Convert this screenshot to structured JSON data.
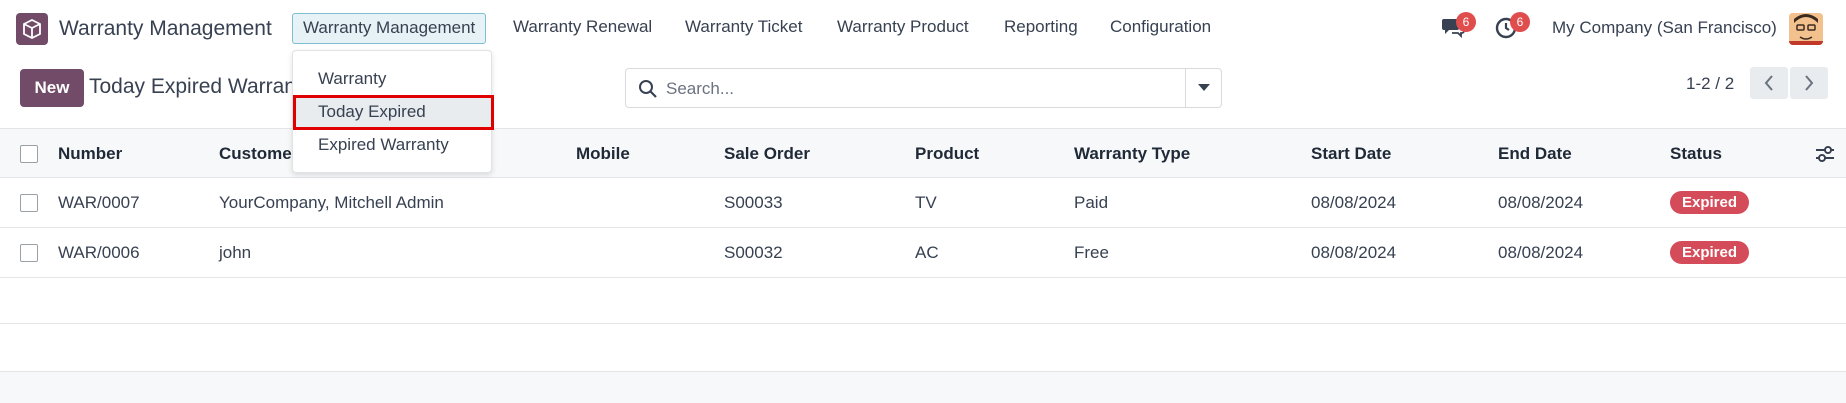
{
  "navbar": {
    "app_name": "Warranty Management",
    "menus": [
      "Warranty Management",
      "Warranty Renewal",
      "Warranty Ticket",
      "Warranty Product",
      "Reporting",
      "Configuration"
    ],
    "messages_count": "6",
    "activities_count": "6",
    "company": "My Company (San Francisco)"
  },
  "dropdown": {
    "items": [
      "Warranty",
      "Today Expired",
      "Expired Warranty"
    ],
    "highlighted": "Today Expired"
  },
  "control_panel": {
    "new_label": "New",
    "title": "Today Expired Warranty",
    "search_placeholder": "Search...",
    "pager": "1-2 / 2"
  },
  "table": {
    "columns": [
      "Number",
      "Customer",
      "Mobile",
      "Sale Order",
      "Product",
      "Warranty Type",
      "Start Date",
      "End Date",
      "Status"
    ],
    "rows": [
      {
        "number": "WAR/0007",
        "customer": "YourCompany, Mitchell Admin",
        "mobile": "",
        "sale_order": "S00033",
        "product": "TV",
        "warranty_type": "Paid",
        "start_date": "08/08/2024",
        "end_date": "08/08/2024",
        "status": "Expired"
      },
      {
        "number": "WAR/0006",
        "customer": "john",
        "mobile": "",
        "sale_order": "S00032",
        "product": "AC",
        "warranty_type": "Free",
        "start_date": "08/08/2024",
        "end_date": "08/08/2024",
        "status": "Expired"
      }
    ]
  },
  "colors": {
    "brand": "#714b67",
    "badge": "#e04d4d",
    "status_expired": "#d44c59",
    "highlight_box": "#e00000"
  },
  "icons": [
    "app-logo-icon",
    "chat-icon",
    "activity-clock-icon",
    "search-icon",
    "caret-down-icon",
    "chevron-left-icon",
    "chevron-right-icon",
    "optional-columns-icon"
  ]
}
